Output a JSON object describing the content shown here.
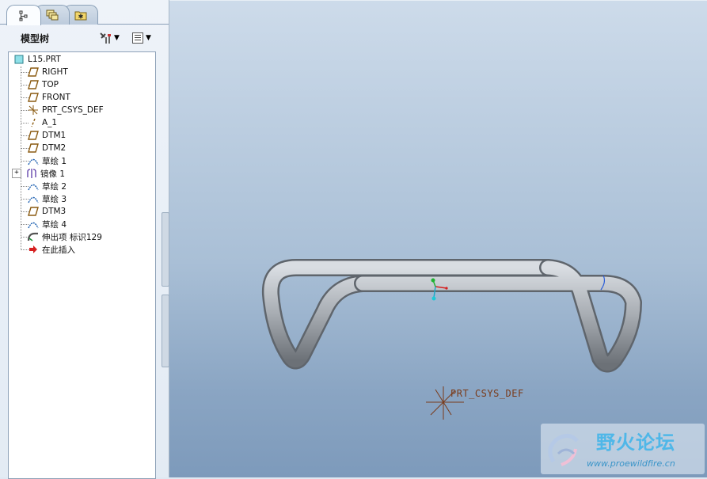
{
  "navigator": {
    "tabs": [
      {
        "name": "model-tree-tab",
        "icon": "model-tree-icon",
        "active": true
      },
      {
        "name": "layers-tab",
        "icon": "layers-icon",
        "active": false
      },
      {
        "name": "favorites-tab",
        "icon": "folder-star-icon",
        "active": false
      }
    ],
    "tree_title": "模型树",
    "settings_icon": "tools-settings-icon",
    "show_icon": "tree-show-icon"
  },
  "tree": {
    "root": {
      "label": "L15.PRT",
      "icon": "part-icon"
    },
    "items": [
      {
        "label": "RIGHT",
        "icon": "datum-plane-icon"
      },
      {
        "label": "TOP",
        "icon": "datum-plane-icon"
      },
      {
        "label": "FRONT",
        "icon": "datum-plane-icon"
      },
      {
        "label": "PRT_CSYS_DEF",
        "icon": "csys-icon"
      },
      {
        "label": "A_1",
        "icon": "datum-axis-icon"
      },
      {
        "label": "DTM1",
        "icon": "datum-plane-icon"
      },
      {
        "label": "DTM2",
        "icon": "datum-plane-icon"
      },
      {
        "label": "草绘 1",
        "icon": "sketch-icon"
      },
      {
        "label": "镜像 1",
        "icon": "mirror-icon",
        "expandable": true
      },
      {
        "label": "草绘 2",
        "icon": "sketch-icon"
      },
      {
        "label": "草绘 3",
        "icon": "sketch-icon"
      },
      {
        "label": "DTM3",
        "icon": "datum-plane-icon"
      },
      {
        "label": "草绘 4",
        "icon": "sketch-icon"
      },
      {
        "label": "伸出项 标识129",
        "icon": "sweep-protrusion-icon"
      },
      {
        "label": "在此插入",
        "icon": "insert-here-arrow-icon"
      }
    ]
  },
  "viewport": {
    "csys_label": "PRT_CSYS_DEF",
    "watermark_title": "野火论坛",
    "watermark_url": "www.proewildfire.cn"
  },
  "colors": {
    "pipe": "#a7acb2",
    "csys": "#7a3b1a",
    "watermark": "#4fb7e8"
  }
}
